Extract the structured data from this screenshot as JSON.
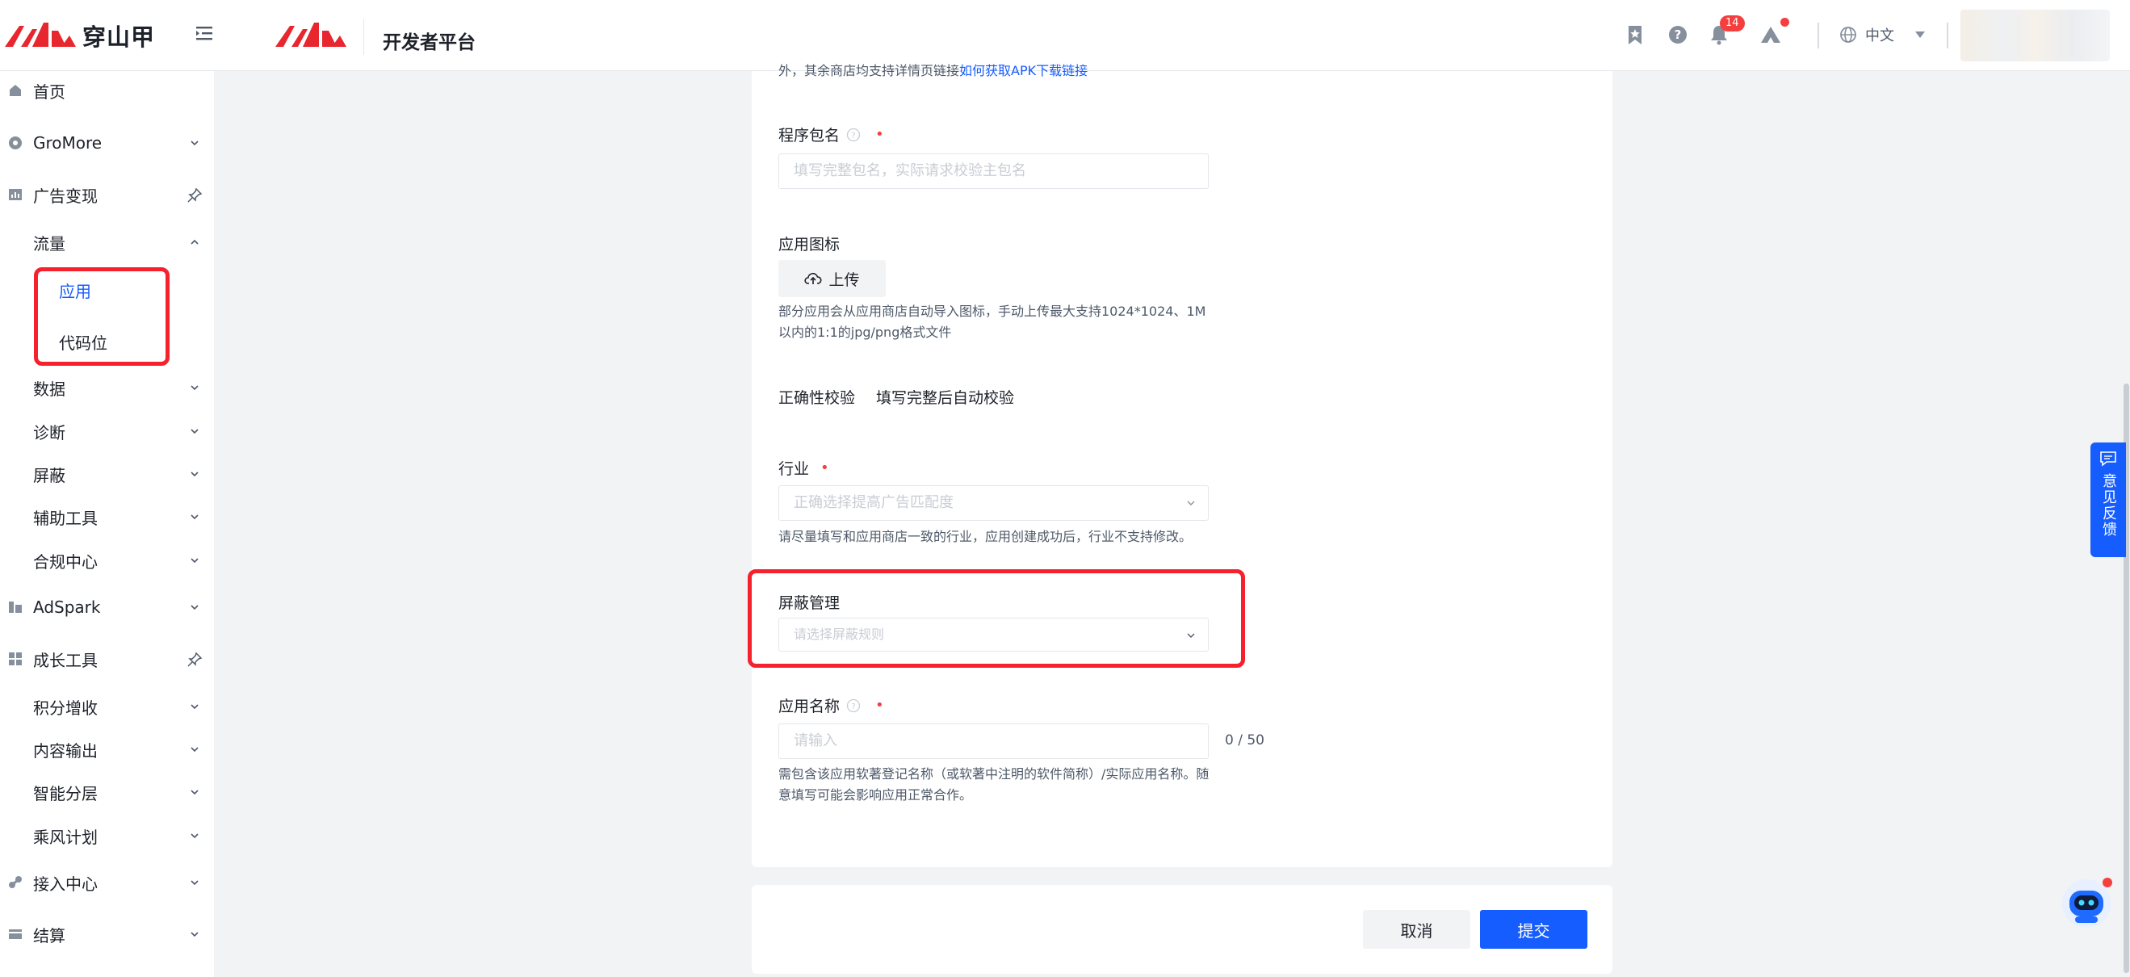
{
  "header": {
    "brand": "穿山甲",
    "platform_title": "开发者平台",
    "notification_count": "14",
    "language": "中文"
  },
  "sidebar": {
    "items": [
      {
        "label": "首页",
        "icon": "home-icon"
      },
      {
        "label": "GroMore",
        "icon": "gromore-icon"
      },
      {
        "label": "广告变现",
        "icon": "chart-icon"
      },
      {
        "label": "流量"
      },
      {
        "label": "应用",
        "active": true
      },
      {
        "label": "代码位"
      },
      {
        "label": "数据"
      },
      {
        "label": "诊断"
      },
      {
        "label": "屏蔽"
      },
      {
        "label": "辅助工具"
      },
      {
        "label": "合规中心"
      },
      {
        "label": "AdSpark",
        "icon": "adspark-icon"
      },
      {
        "label": "成长工具",
        "icon": "grid-icon"
      },
      {
        "label": "积分增收"
      },
      {
        "label": "内容输出"
      },
      {
        "label": "智能分层"
      },
      {
        "label": "乘风计划"
      },
      {
        "label": "接入中心",
        "icon": "access-icon"
      },
      {
        "label": "结算",
        "icon": "wallet-icon"
      }
    ]
  },
  "form": {
    "top_help_prefix": "外，其余商店均支持详情页链接",
    "top_help_link": "如何获取APK下载链接",
    "package_label": "程序包名",
    "package_placeholder": "填写完整包名，实际请求校验主包名",
    "icon_label": "应用图标",
    "upload_label": "上传",
    "icon_help_line1": "部分应用会从应用商店自动导入图标，手动上传最大支持1024*1024、1M",
    "icon_help_line2": "以内的1:1的jpg/png格式文件",
    "verify_label": "正确性校验",
    "verify_value": "填写完整后自动校验",
    "industry_label": "行业",
    "industry_placeholder": "正确选择提高广告匹配度",
    "industry_help": "请尽量填写和应用商店一致的行业，应用创建成功后，行业不支持修改。",
    "shield_label": "屏蔽管理",
    "shield_placeholder": "请选择屏蔽规则",
    "name_label": "应用名称",
    "name_placeholder": "请输入",
    "name_counter": "0 / 50",
    "name_help_line1": "需包含该应用软著登记名称（或软著中注明的软件简称）/实际应用名称。随",
    "name_help_line2": "意填写可能会影响应用正常合作。"
  },
  "actions": {
    "cancel": "取消",
    "submit": "提交"
  },
  "feedback": {
    "label": "意见反馈"
  },
  "colors": {
    "primary": "#165dff",
    "brand_red": "#e8262d",
    "highlight_red": "#f5222d",
    "required": "#f53f3f"
  }
}
